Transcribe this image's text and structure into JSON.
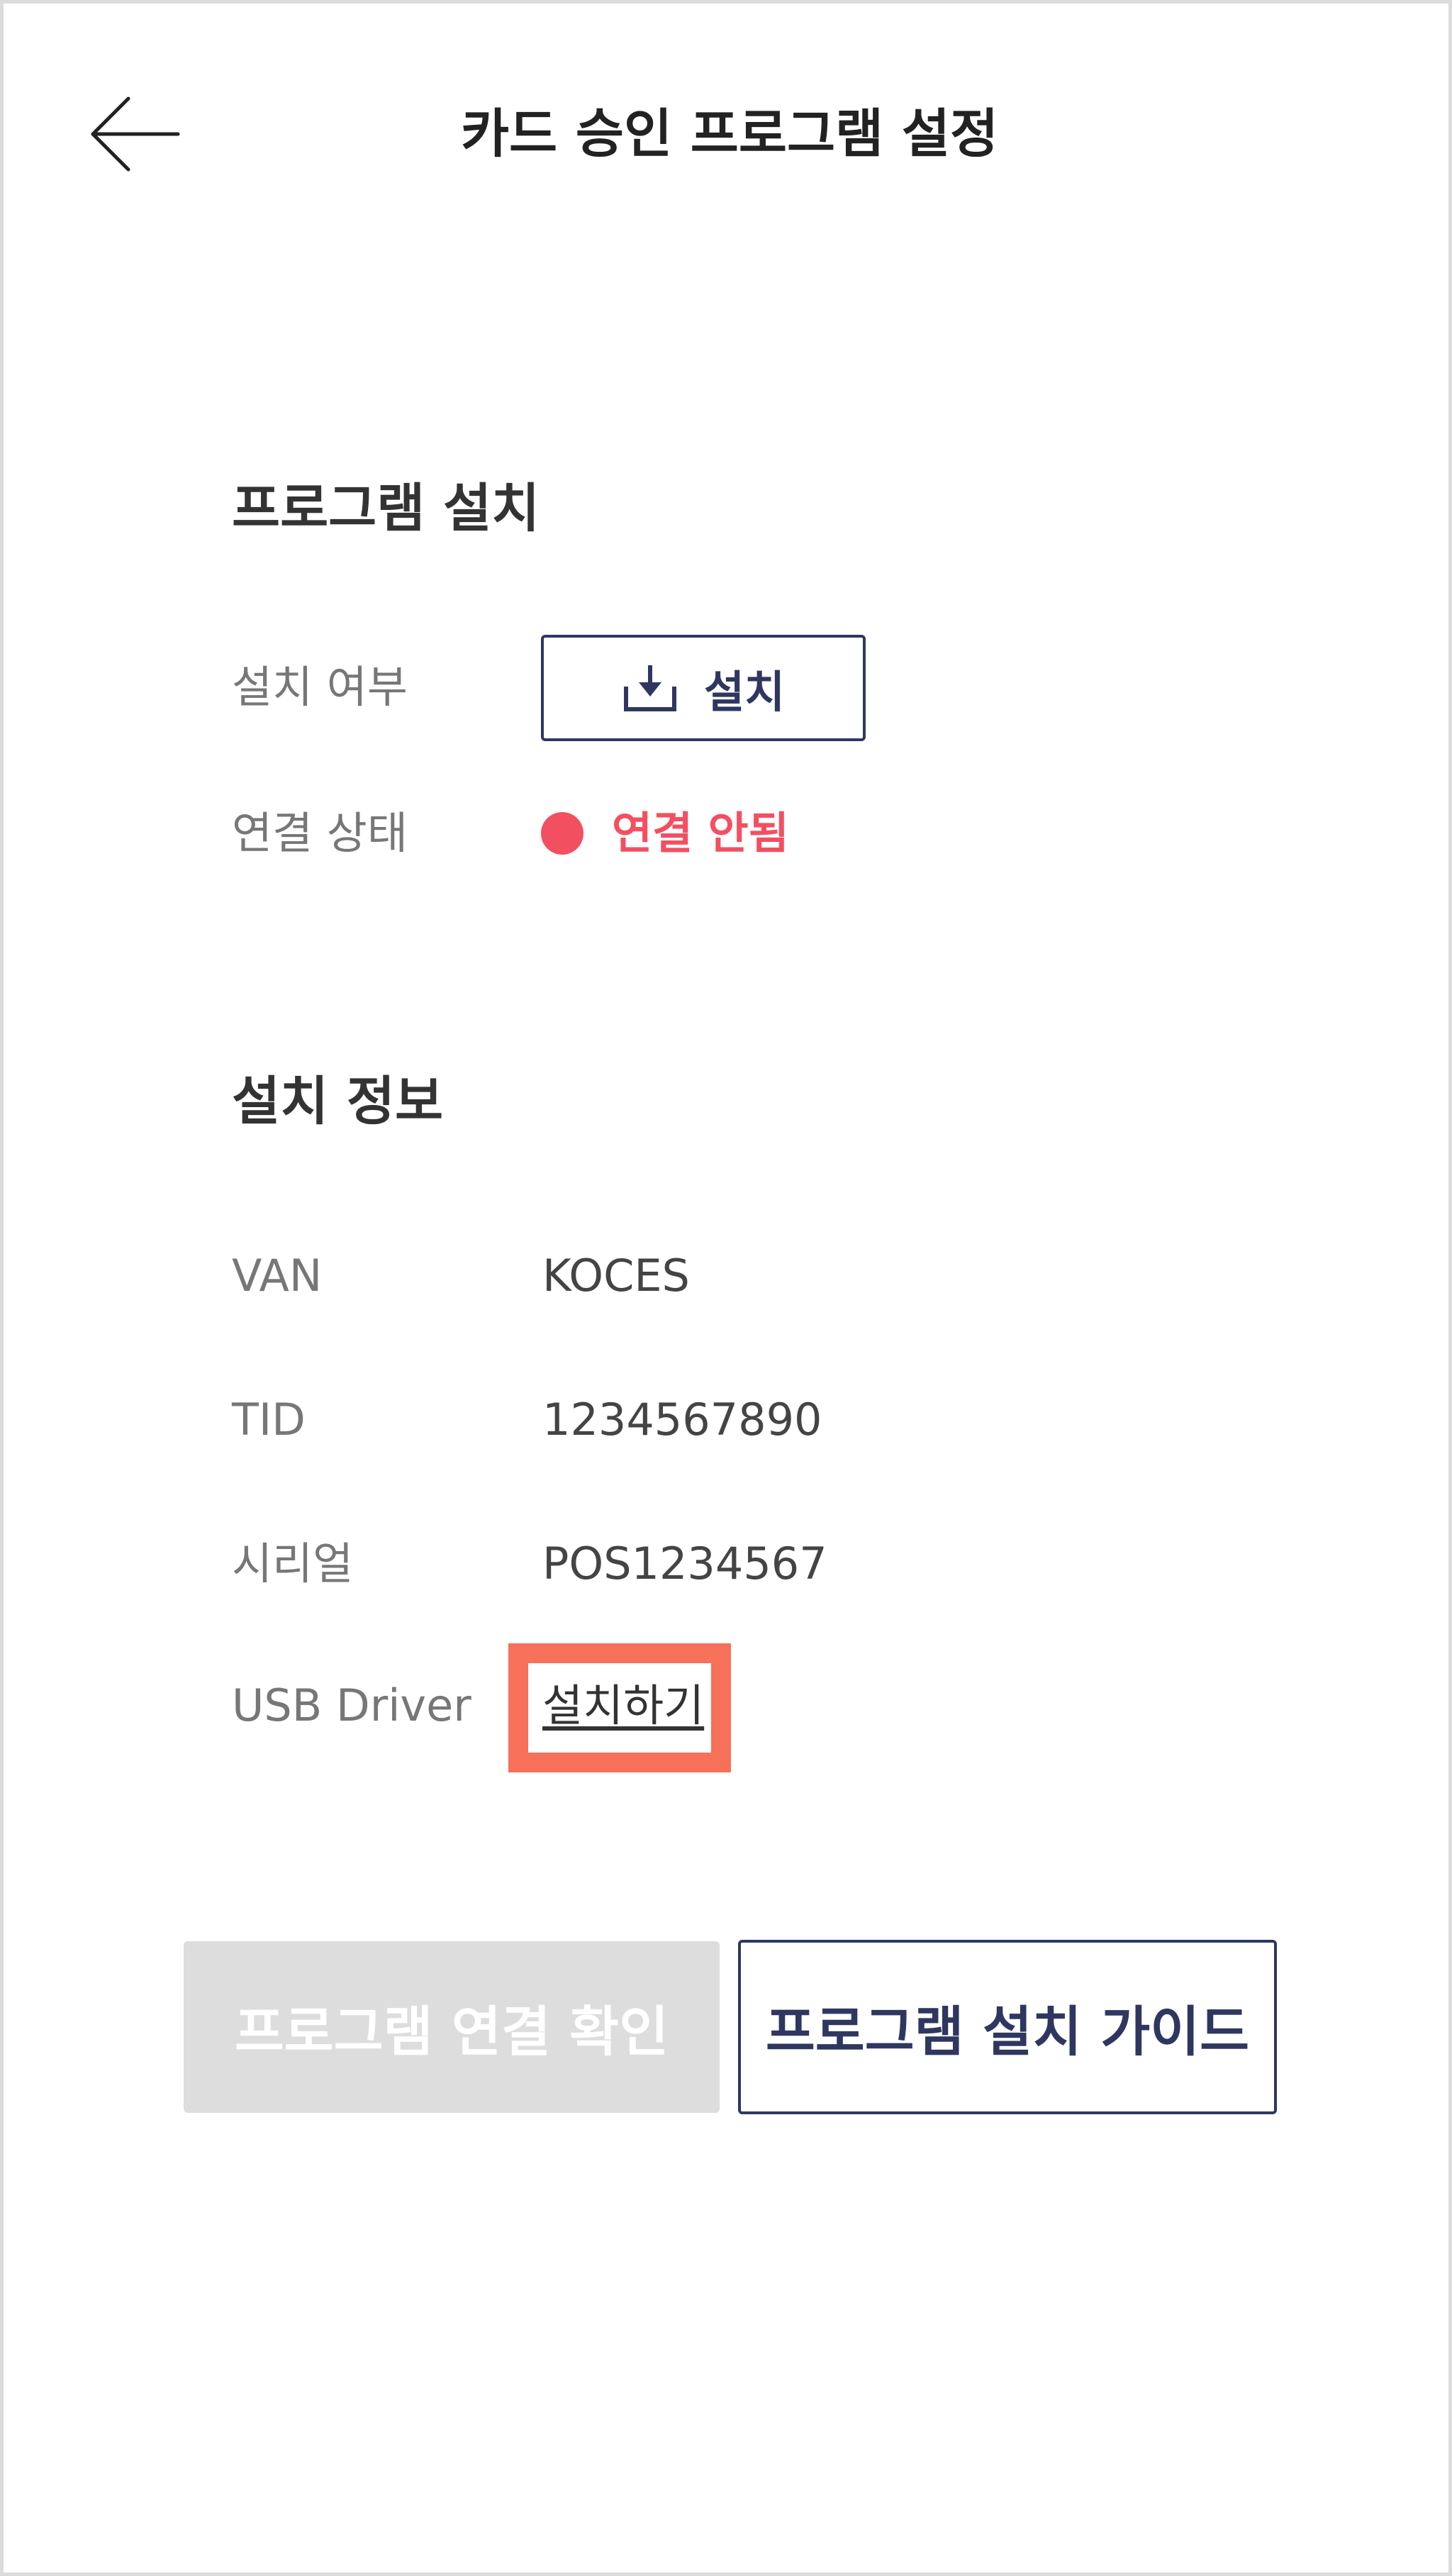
{
  "header": {
    "back_icon": "arrow-left-icon",
    "title": "카드 승인 프로그램 설정"
  },
  "install_section": {
    "title": "프로그램 설치",
    "install_status_label": "설치 여부",
    "install_button_label": "설치",
    "install_button_icon": "download-icon",
    "connection_label": "연결 상태",
    "connection_value": "연결 안됨",
    "connection_color": "#f25060"
  },
  "info_section": {
    "title": "설치 정보",
    "rows": [
      {
        "label": "VAN",
        "value": "KOCES"
      },
      {
        "label": "TID",
        "value": "1234567890"
      },
      {
        "label": "시리얼",
        "value": "POS1234567"
      }
    ],
    "usb_driver_label": "USB Driver",
    "usb_driver_link": "설치하기",
    "highlight_color": "#f7705a"
  },
  "actions": {
    "confirm_label": "프로그램 연결 확인",
    "guide_label": "프로그램 설치 가이드"
  },
  "colors": {
    "primary": "#2f3760",
    "disabled": "#dddddd"
  }
}
